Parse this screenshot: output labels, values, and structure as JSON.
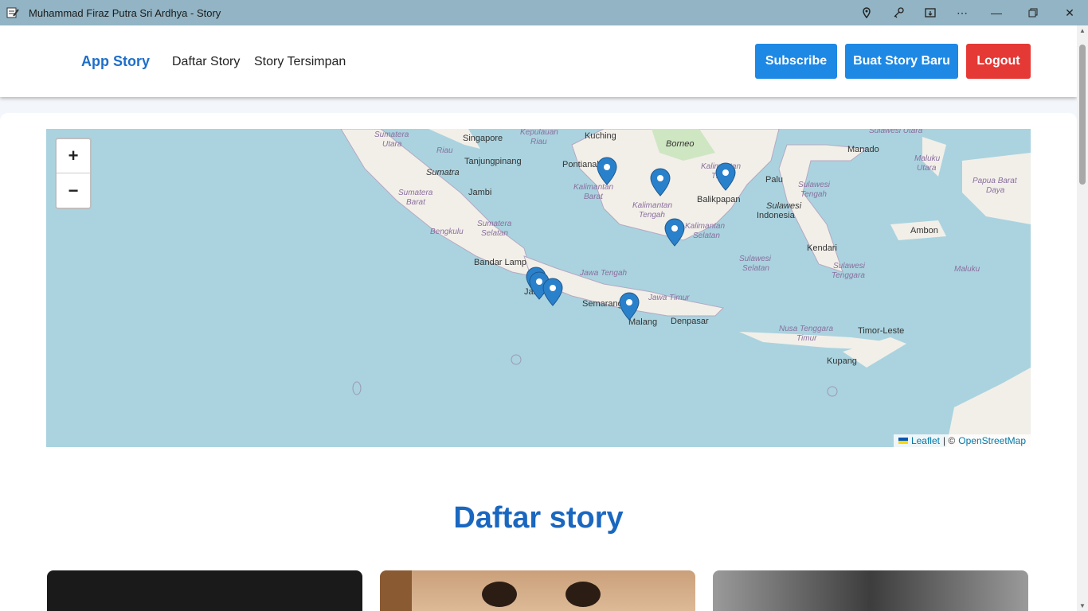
{
  "window": {
    "title": "Muhammad Firaz Putra Sri Ardhya - Story"
  },
  "nav": {
    "brand": "App Story",
    "links": [
      "Daftar Story",
      "Story Tersimpan"
    ],
    "subscribe": "Subscribe",
    "new_story": "Buat Story Baru",
    "logout": "Logout"
  },
  "map": {
    "zoom_in": "+",
    "zoom_out": "−",
    "attribution": {
      "leaflet": "Leaflet",
      "separator": "| ©",
      "osm": "OpenStreetMap"
    },
    "labels": [
      "Singapore",
      "Tanjungpinang",
      "Sumatra",
      "Jambi",
      "Bandar Lamp",
      "Jakarta",
      "Semarang",
      "Malang",
      "Denpasar",
      "Pontianak",
      "Kuching",
      "Borneo",
      "Balikpapan",
      "Palu",
      "Manado",
      "Indonesia",
      "Sulawesi",
      "Kendari",
      "Ambon",
      "Timor-Leste",
      "Kupang",
      "Bengkulu"
    ],
    "region_labels": [
      "Sumatera Utara",
      "Riau",
      "Sumatera Barat",
      "Sumatera Selatan",
      "Kepulauan Riau",
      "Kalimantan Barat",
      "Kalimantan Tengah",
      "Kalimantan Selatan",
      "Kalimantan Timur",
      "Jawa Tengah",
      "Jawa Timur",
      "Sulawesi Tengah",
      "Sulawesi Selatan",
      "Sulawesi Tenggara",
      "Nusa Tenggara Timur",
      "Maluku",
      "Maluku Utara",
      "Papua Barat Daya",
      "Sulawesi Utara"
    ],
    "markers": 8
  },
  "content": {
    "section_title": "Daftar story"
  },
  "colors": {
    "accent": "#1e88e5",
    "danger": "#e53935",
    "brand": "#1e6fc9",
    "titlebar": "#92b4c4"
  }
}
